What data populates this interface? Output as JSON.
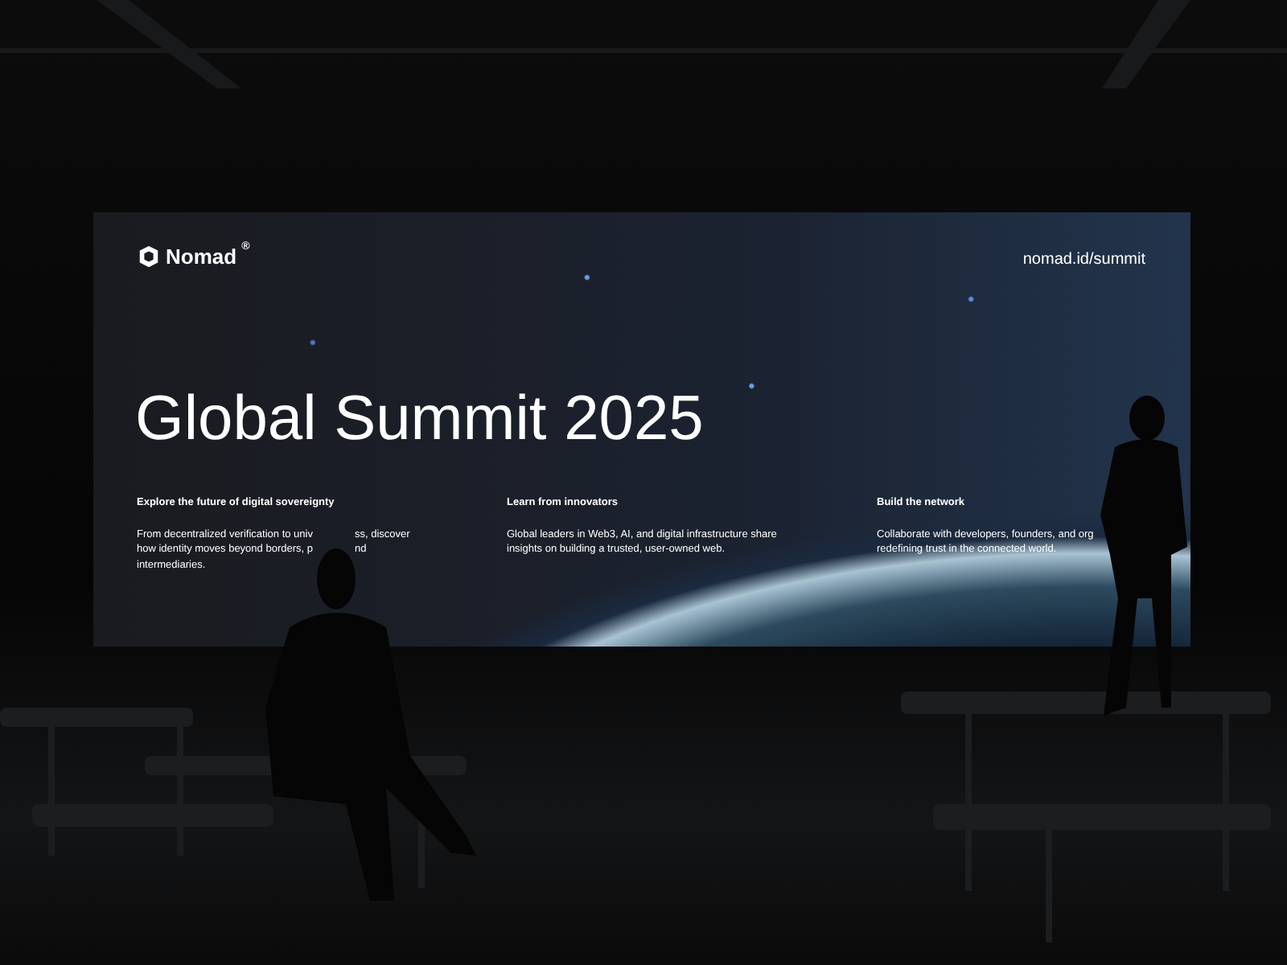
{
  "slide": {
    "logo": {
      "text": "Nomad",
      "mark": "®"
    },
    "url": "nomad.id/summit",
    "title": "Global Summit 2025",
    "columns": [
      {
        "heading": "Explore the future of digital sovereignty",
        "lines": [
          [
            "From decentralized verification to univ",
            "ss, discover"
          ],
          [
            "how identity moves beyond borders, p",
            "nd"
          ],
          [
            "intermediaries."
          ]
        ]
      },
      {
        "heading": "Learn from innovators",
        "lines": [
          [
            "Global leaders in Web3, AI, and digital infrastructure share"
          ],
          [
            "insights on building a trusted, user-owned web."
          ]
        ]
      },
      {
        "heading": "Build the network",
        "lines": [
          [
            "Collaborate with developers, founders, and org"
          ],
          [
            "redefining trust in the connected world."
          ]
        ]
      }
    ]
  }
}
